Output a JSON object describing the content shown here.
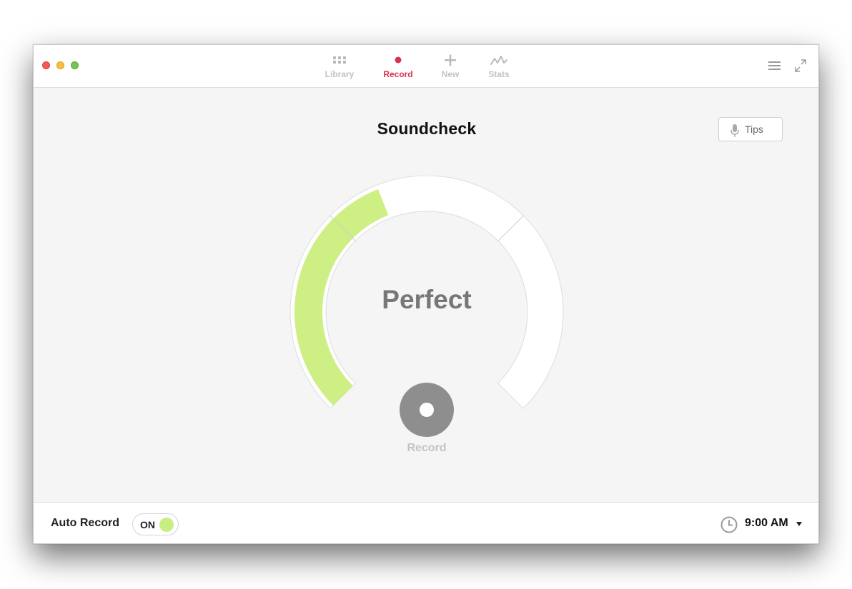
{
  "nav": {
    "tabs": [
      {
        "label": "Library",
        "icon": "grid-icon"
      },
      {
        "label": "Record",
        "icon": "record-dot-icon",
        "active": true
      },
      {
        "label": "New",
        "icon": "plus-icon"
      },
      {
        "label": "Stats",
        "icon": "stats-line-icon"
      }
    ]
  },
  "main": {
    "title": "Soundcheck",
    "tips_label": "Tips",
    "level_status": "Perfect",
    "level_fraction": 0.42,
    "record_label": "Record"
  },
  "footer": {
    "auto_record_label": "Auto Record",
    "toggle_state": "ON",
    "time": "9:00 AM"
  },
  "colors": {
    "accent_red": "#d7334f",
    "level_green": "#cdef84",
    "record_gray": "#8e8e8e"
  }
}
